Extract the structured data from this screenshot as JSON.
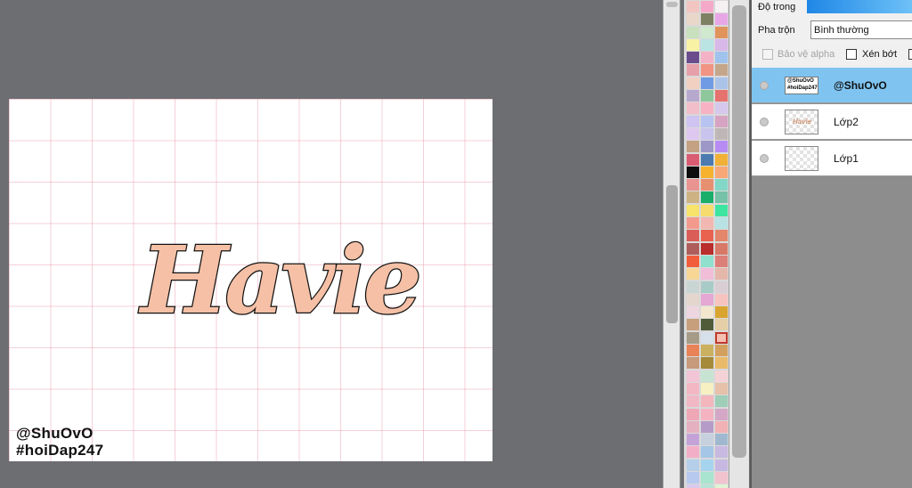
{
  "canvas": {
    "lettering": "Havie",
    "lettering_fill": "#f5c0a6",
    "lettering_stroke": "#111111",
    "grid_color": "#e896aa",
    "watermark": {
      "line1": "@ShuOvO",
      "line2": "#hoiDap247"
    }
  },
  "palette": {
    "selected_index": 80,
    "colors": [
      "#f3c5c0",
      "#f4a9c8",
      "#f5f0f2",
      "#e9d7c9",
      "#7d8063",
      "#e7a7e6",
      "#c8e0be",
      "#cfe9cf",
      "#e0945c",
      "#f8f2a5",
      "#b9e4e3",
      "#d7b8e9",
      "#6a4c8d",
      "#f4b2c7",
      "#a0c3ee",
      "#e6a0a9",
      "#f29484",
      "#c4a68b",
      "#f1d0c2",
      "#6f9be5",
      "#abc3e8",
      "#b7a9ce",
      "#8fc79c",
      "#e5726e",
      "#f1bec9",
      "#f7b2c4",
      "#d5c8ec",
      "#cfc3f2",
      "#b7c3f0",
      "#d6a3c2",
      "#dfc8ef",
      "#c8c4ee",
      "#bfb7b7",
      "#c3a182",
      "#9d97c7",
      "#b78cf2",
      "#d95c73",
      "#4a7ab0",
      "#f1b036",
      "#0d0d0d",
      "#f6b22d",
      "#f8a776",
      "#e99490",
      "#e79071",
      "#83d7c6",
      "#cdb384",
      "#1aae6b",
      "#77c1a8",
      "#f7e36a",
      "#f6dc6c",
      "#3ee5a0",
      "#f39a8d",
      "#f2b7b0",
      "#b8e2e3",
      "#da5d57",
      "#e9624f",
      "#e3866c",
      "#ae5d5a",
      "#b92d2c",
      "#d87867",
      "#f15d3a",
      "#8fe0cd",
      "#dc7f78",
      "#f7d696",
      "#f1bdd9",
      "#e5b7ab",
      "#c9d5d2",
      "#a9cbc8",
      "#d9ced4",
      "#e5d6cd",
      "#e5a7d3",
      "#f7c3bf",
      "#eed6e1",
      "#f3e6cf",
      "#d9a530",
      "#c89f7c",
      "#505b3a",
      "#e5cfa6",
      "#a69b87",
      "#d6e0ea",
      "#f5c0b2",
      "#e98256",
      "#cbb05f",
      "#d4a05e",
      "#c69a7a",
      "#a48a3a",
      "#e9ba69",
      "#f1c5d5",
      "#c7e3d2",
      "#f4d2d6",
      "#f2b7c3",
      "#f6f0c3",
      "#e6c0a8",
      "#f0b8c5",
      "#f3b6bd",
      "#9ecdb8",
      "#efa7b5",
      "#f5b3c2",
      "#d4a7c6",
      "#e4b1c1",
      "#b59cc8",
      "#f2b1b4",
      "#c3a3d7",
      "#c7d0df",
      "#a0b8cf",
      "#f3aec7",
      "#a5c6e6",
      "#c8b9e0",
      "#b5cee9",
      "#a6d4ee",
      "#c7b8e2",
      "#b7c9ef",
      "#a8e4cf",
      "#f3c2cf",
      "#d9c9ec",
      "#b7e2d5",
      "#e1f3d2",
      "#c8d9f1",
      "#f3e2b9",
      "#b7e2d5"
    ]
  },
  "layers_panel": {
    "opacity_label": "Độ trong",
    "blend_label": "Pha trộn",
    "blend_value": "Bình thường",
    "protect_alpha_label": "Bảo vệ alpha",
    "clipping_label": "Xén bớt",
    "layers": [
      {
        "name": "@ShuOvO",
        "active": true,
        "thumb_line1": "@ShuOvO",
        "thumb_line2": "#hoiDap247"
      },
      {
        "name": "Lớp2",
        "active": false,
        "thumb_text": "Havie"
      },
      {
        "name": "Lớp1",
        "active": false
      }
    ]
  }
}
